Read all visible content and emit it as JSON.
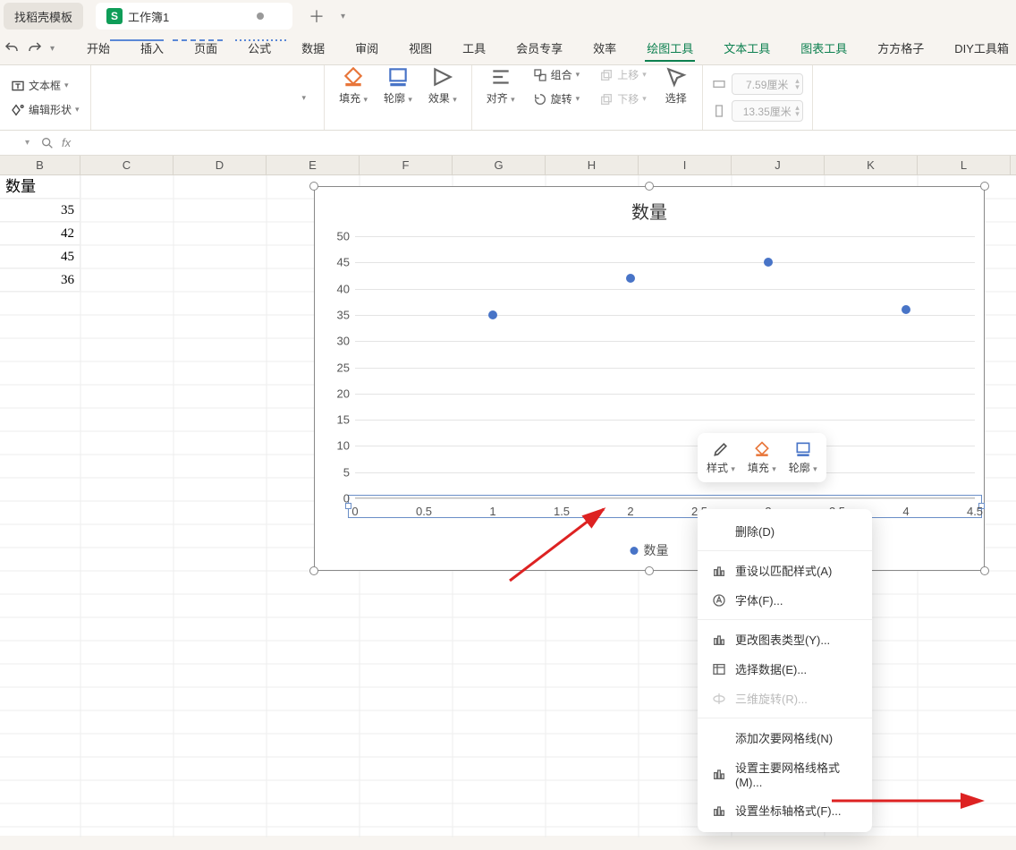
{
  "tabs": {
    "inactive_label": "找稻壳模板",
    "active_label": "工作簿1"
  },
  "menu": {
    "items": [
      "开始",
      "插入",
      "页面",
      "公式",
      "数据",
      "审阅",
      "视图",
      "工具",
      "会员专享",
      "效率",
      "绘图工具",
      "文本工具",
      "图表工具",
      "方方格子",
      "DIY工具箱"
    ],
    "active_index": 10
  },
  "ribbon": {
    "textbox": "文本框",
    "edit_shape": "编辑形状",
    "fill": "填充",
    "outline": "轮廓",
    "effect": "效果",
    "align": "对齐",
    "group": "组合",
    "rotate": "旋转",
    "move_up": "上移",
    "move_down": "下移",
    "select": "选择",
    "width": "7.59厘米",
    "height": "13.35厘米"
  },
  "formula_bar": {
    "fx": "fx",
    "value": ""
  },
  "columns": [
    "B",
    "C",
    "D",
    "E",
    "F",
    "G",
    "H",
    "I",
    "J",
    "K",
    "L"
  ],
  "cells": {
    "header": "数量",
    "values": [
      "35",
      "42",
      "45",
      "36"
    ]
  },
  "chart_data": {
    "type": "scatter",
    "title": "数量",
    "x": [
      1,
      2,
      3,
      4
    ],
    "y": [
      35,
      42,
      45,
      36
    ],
    "legend": "数量",
    "xlim": [
      0,
      4.5
    ],
    "ylim": [
      0,
      50
    ],
    "xticks": [
      0,
      0.5,
      1,
      1.5,
      2,
      2.5,
      3,
      3.5,
      4,
      4.5
    ],
    "yticks": [
      0,
      5,
      10,
      15,
      20,
      25,
      30,
      35,
      40,
      45,
      50
    ]
  },
  "mini_toolbar": {
    "style": "样式",
    "fill": "填充",
    "outline": "轮廓"
  },
  "context_menu": {
    "delete": "删除(D)",
    "reset": "重设以匹配样式(A)",
    "font": "字体(F)...",
    "change_type": "更改图表类型(Y)...",
    "select_data": "选择数据(E)...",
    "rotate3d": "三维旋转(R)...",
    "add_minor": "添加次要网格线(N)",
    "major_grid": "设置主要网格线格式(M)...",
    "axis_format": "设置坐标轴格式(F)..."
  }
}
